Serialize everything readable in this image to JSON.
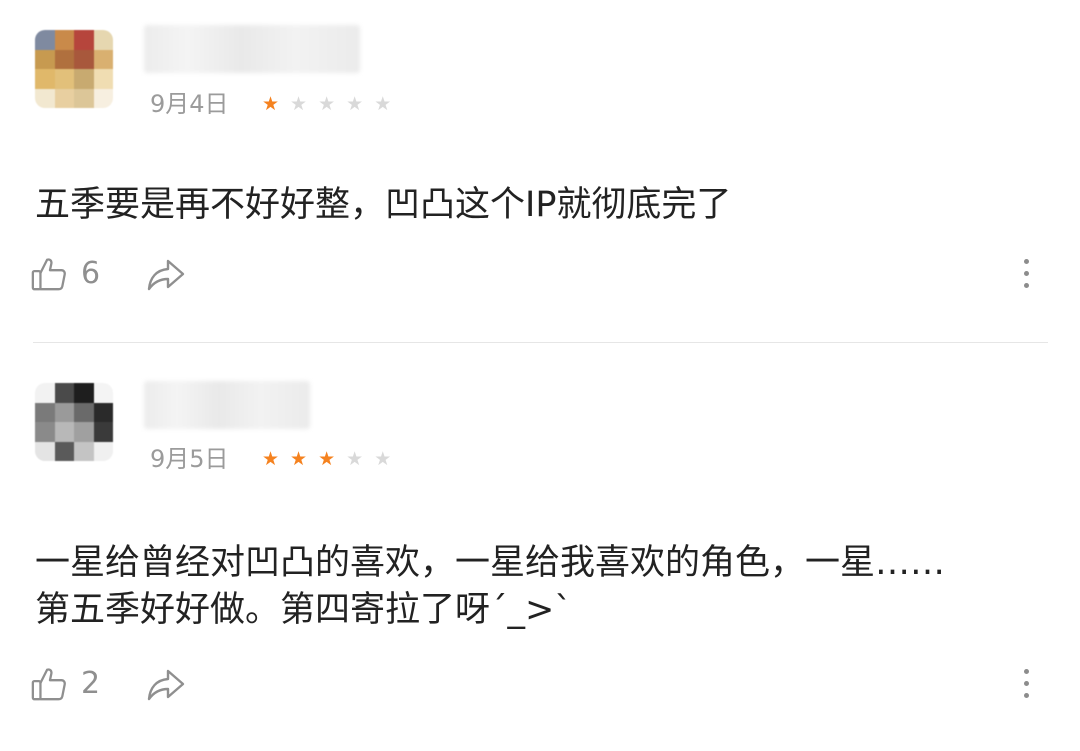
{
  "comments": [
    {
      "date": "9月4日",
      "rating": 1,
      "rating_max": 5,
      "text": "五季要是再不好好整，凹凸这个IP就彻底完了",
      "likes": "6"
    },
    {
      "date": "9月5日",
      "rating": 3,
      "rating_max": 5,
      "text": "一星给曾经对凹凸的喜欢，一星给我喜欢的角色，一星……\n第五季好好做。第四寄拉了呀ˊ_>ˋ",
      "likes": "2"
    }
  ],
  "icons": {
    "like": "thumbs-up-icon",
    "share": "share-icon",
    "more": "more-vertical-icon"
  },
  "colors": {
    "star_on": "#f5821f",
    "star_off": "#d9d9d9",
    "meta_text": "#9b9b9b",
    "body_text": "#222222"
  }
}
